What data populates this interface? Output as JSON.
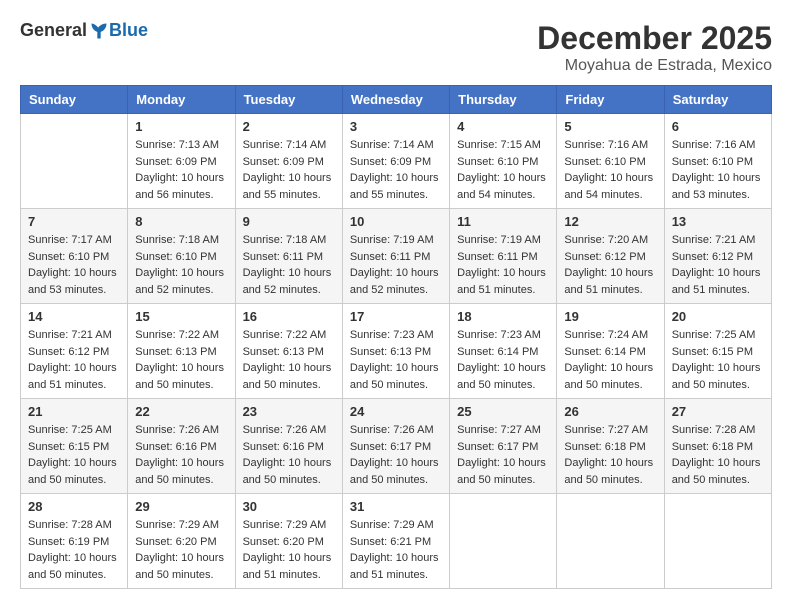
{
  "header": {
    "logo": {
      "general": "General",
      "blue": "Blue"
    },
    "title": "December 2025",
    "subtitle": "Moyahua de Estrada, Mexico"
  },
  "calendar": {
    "days_of_week": [
      "Sunday",
      "Monday",
      "Tuesday",
      "Wednesday",
      "Thursday",
      "Friday",
      "Saturday"
    ],
    "weeks": [
      [
        {
          "day": "",
          "info": ""
        },
        {
          "day": "1",
          "info": "Sunrise: 7:13 AM\nSunset: 6:09 PM\nDaylight: 10 hours\nand 56 minutes."
        },
        {
          "day": "2",
          "info": "Sunrise: 7:14 AM\nSunset: 6:09 PM\nDaylight: 10 hours\nand 55 minutes."
        },
        {
          "day": "3",
          "info": "Sunrise: 7:14 AM\nSunset: 6:09 PM\nDaylight: 10 hours\nand 55 minutes."
        },
        {
          "day": "4",
          "info": "Sunrise: 7:15 AM\nSunset: 6:10 PM\nDaylight: 10 hours\nand 54 minutes."
        },
        {
          "day": "5",
          "info": "Sunrise: 7:16 AM\nSunset: 6:10 PM\nDaylight: 10 hours\nand 54 minutes."
        },
        {
          "day": "6",
          "info": "Sunrise: 7:16 AM\nSunset: 6:10 PM\nDaylight: 10 hours\nand 53 minutes."
        }
      ],
      [
        {
          "day": "7",
          "info": "Sunrise: 7:17 AM\nSunset: 6:10 PM\nDaylight: 10 hours\nand 53 minutes."
        },
        {
          "day": "8",
          "info": "Sunrise: 7:18 AM\nSunset: 6:10 PM\nDaylight: 10 hours\nand 52 minutes."
        },
        {
          "day": "9",
          "info": "Sunrise: 7:18 AM\nSunset: 6:11 PM\nDaylight: 10 hours\nand 52 minutes."
        },
        {
          "day": "10",
          "info": "Sunrise: 7:19 AM\nSunset: 6:11 PM\nDaylight: 10 hours\nand 52 minutes."
        },
        {
          "day": "11",
          "info": "Sunrise: 7:19 AM\nSunset: 6:11 PM\nDaylight: 10 hours\nand 51 minutes."
        },
        {
          "day": "12",
          "info": "Sunrise: 7:20 AM\nSunset: 6:12 PM\nDaylight: 10 hours\nand 51 minutes."
        },
        {
          "day": "13",
          "info": "Sunrise: 7:21 AM\nSunset: 6:12 PM\nDaylight: 10 hours\nand 51 minutes."
        }
      ],
      [
        {
          "day": "14",
          "info": "Sunrise: 7:21 AM\nSunset: 6:12 PM\nDaylight: 10 hours\nand 51 minutes."
        },
        {
          "day": "15",
          "info": "Sunrise: 7:22 AM\nSunset: 6:13 PM\nDaylight: 10 hours\nand 50 minutes."
        },
        {
          "day": "16",
          "info": "Sunrise: 7:22 AM\nSunset: 6:13 PM\nDaylight: 10 hours\nand 50 minutes."
        },
        {
          "day": "17",
          "info": "Sunrise: 7:23 AM\nSunset: 6:13 PM\nDaylight: 10 hours\nand 50 minutes."
        },
        {
          "day": "18",
          "info": "Sunrise: 7:23 AM\nSunset: 6:14 PM\nDaylight: 10 hours\nand 50 minutes."
        },
        {
          "day": "19",
          "info": "Sunrise: 7:24 AM\nSunset: 6:14 PM\nDaylight: 10 hours\nand 50 minutes."
        },
        {
          "day": "20",
          "info": "Sunrise: 7:25 AM\nSunset: 6:15 PM\nDaylight: 10 hours\nand 50 minutes."
        }
      ],
      [
        {
          "day": "21",
          "info": "Sunrise: 7:25 AM\nSunset: 6:15 PM\nDaylight: 10 hours\nand 50 minutes."
        },
        {
          "day": "22",
          "info": "Sunrise: 7:26 AM\nSunset: 6:16 PM\nDaylight: 10 hours\nand 50 minutes."
        },
        {
          "day": "23",
          "info": "Sunrise: 7:26 AM\nSunset: 6:16 PM\nDaylight: 10 hours\nand 50 minutes."
        },
        {
          "day": "24",
          "info": "Sunrise: 7:26 AM\nSunset: 6:17 PM\nDaylight: 10 hours\nand 50 minutes."
        },
        {
          "day": "25",
          "info": "Sunrise: 7:27 AM\nSunset: 6:17 PM\nDaylight: 10 hours\nand 50 minutes."
        },
        {
          "day": "26",
          "info": "Sunrise: 7:27 AM\nSunset: 6:18 PM\nDaylight: 10 hours\nand 50 minutes."
        },
        {
          "day": "27",
          "info": "Sunrise: 7:28 AM\nSunset: 6:18 PM\nDaylight: 10 hours\nand 50 minutes."
        }
      ],
      [
        {
          "day": "28",
          "info": "Sunrise: 7:28 AM\nSunset: 6:19 PM\nDaylight: 10 hours\nand 50 minutes."
        },
        {
          "day": "29",
          "info": "Sunrise: 7:29 AM\nSunset: 6:20 PM\nDaylight: 10 hours\nand 50 minutes."
        },
        {
          "day": "30",
          "info": "Sunrise: 7:29 AM\nSunset: 6:20 PM\nDaylight: 10 hours\nand 51 minutes."
        },
        {
          "day": "31",
          "info": "Sunrise: 7:29 AM\nSunset: 6:21 PM\nDaylight: 10 hours\nand 51 minutes."
        },
        {
          "day": "",
          "info": ""
        },
        {
          "day": "",
          "info": ""
        },
        {
          "day": "",
          "info": ""
        }
      ]
    ]
  }
}
